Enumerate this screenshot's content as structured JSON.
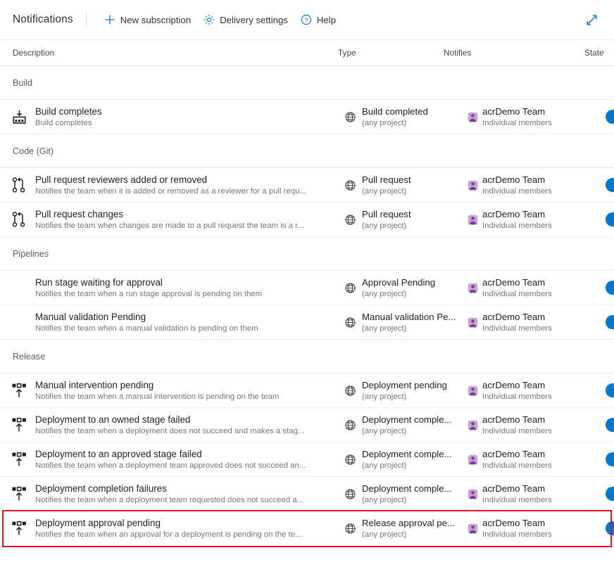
{
  "toolbar": {
    "title": "Notifications",
    "actions": [
      {
        "label": "New subscription",
        "icon": "plus-icon"
      },
      {
        "label": "Delivery settings",
        "icon": "gear-icon"
      },
      {
        "label": "Help",
        "icon": "help-circle-icon"
      }
    ],
    "expand_icon": "expand-diagonal-icon"
  },
  "columns": {
    "description": "Description",
    "type": "Type",
    "notifies": "Notifies",
    "state": "State"
  },
  "groups": [
    {
      "name": "Build",
      "rows": [
        {
          "icon": "build-icon",
          "title": "Build completes",
          "subtitle": "Build completes",
          "scope_icon": "globe-icon",
          "type": "Build completed",
          "type_sub": "(any project)",
          "notifies": "acrDemo Team",
          "notifies_sub": "Individual members",
          "state": "on",
          "highlighted": false
        }
      ]
    },
    {
      "name": "Code (Git)",
      "rows": [
        {
          "icon": "pull-request-icon",
          "title": "Pull request reviewers added or removed",
          "subtitle": "Notifies the team when it is added or removed as a reviewer for a pull requ...",
          "scope_icon": "globe-icon",
          "type": "Pull request",
          "type_sub": "(any project)",
          "notifies": "acrDemo Team",
          "notifies_sub": "Individual members",
          "state": "on",
          "highlighted": false
        },
        {
          "icon": "pull-request-icon",
          "title": "Pull request changes",
          "subtitle": "Notifies the team when changes are made to a pull request the team is a r...",
          "scope_icon": "globe-icon",
          "type": "Pull request",
          "type_sub": "(any project)",
          "notifies": "acrDemo Team",
          "notifies_sub": "Individual members",
          "state": "on",
          "highlighted": false
        }
      ]
    },
    {
      "name": "Pipelines",
      "rows": [
        {
          "icon": "none",
          "title": "Run stage waiting for approval",
          "subtitle": "Notifies the team when a run stage approval is pending on them",
          "scope_icon": "globe-icon",
          "type": "Approval Pending",
          "type_sub": "(any project)",
          "notifies": "acrDemo Team",
          "notifies_sub": "Individual members",
          "state": "on",
          "highlighted": false
        },
        {
          "icon": "none",
          "title": "Manual validation Pending",
          "subtitle": "Notifies the team when a manual validation is pending on them",
          "scope_icon": "globe-icon",
          "type": "Manual validation Pe...",
          "type_sub": "(any project)",
          "notifies": "acrDemo Team",
          "notifies_sub": "Individual members",
          "state": "on",
          "highlighted": false
        }
      ]
    },
    {
      "name": "Release",
      "rows": [
        {
          "icon": "release-icon",
          "title": "Manual intervention pending",
          "subtitle": "Notifies the team when a manual intervention is pending on the team",
          "scope_icon": "globe-icon",
          "type": "Deployment pending",
          "type_sub": "(any project)",
          "notifies": "acrDemo Team",
          "notifies_sub": "Individual members",
          "state": "on",
          "highlighted": false
        },
        {
          "icon": "release-icon",
          "title": "Deployment to an owned stage failed",
          "subtitle": "Notifies the team when a deployment does not succeed and makes a stag...",
          "scope_icon": "globe-icon",
          "type": "Deployment comple...",
          "type_sub": "(any project)",
          "notifies": "acrDemo Team",
          "notifies_sub": "Individual members",
          "state": "on",
          "highlighted": false
        },
        {
          "icon": "release-icon",
          "title": "Deployment to an approved stage failed",
          "subtitle": "Notifies the team when a deployment team approved does not succeed an...",
          "scope_icon": "globe-icon",
          "type": "Deployment comple...",
          "type_sub": "(any project)",
          "notifies": "acrDemo Team",
          "notifies_sub": "Individual members",
          "state": "on",
          "highlighted": false
        },
        {
          "icon": "release-icon",
          "title": "Deployment completion failures",
          "subtitle": "Notifies the team when a deployment team requested does not succeed a...",
          "scope_icon": "globe-icon",
          "type": "Deployment comple...",
          "type_sub": "(any project)",
          "notifies": "acrDemo Team",
          "notifies_sub": "Individual members",
          "state": "on",
          "highlighted": false
        },
        {
          "icon": "release-icon",
          "title": "Deployment approval pending",
          "subtitle": "Notifies the team when an approval for a deployment is pending on the te...",
          "scope_icon": "globe-icon",
          "type": "Release approval pe...",
          "type_sub": "(any project)",
          "notifies": "acrDemo Team",
          "notifies_sub": "Individual members",
          "state": "on",
          "highlighted": true
        }
      ]
    }
  ],
  "colors": {
    "accent": "#0078d4",
    "toggle_on": "#0078d4",
    "team_icon": "#b46ec1",
    "highlight_border": "#e81123"
  }
}
